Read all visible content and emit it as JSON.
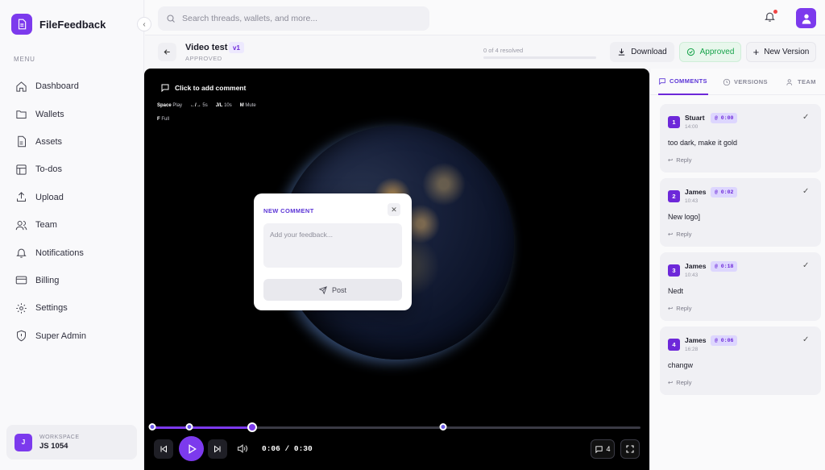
{
  "app": {
    "name": "FileFeedback"
  },
  "sidebar": {
    "menu_label": "MENU",
    "items": [
      {
        "label": "Dashboard",
        "icon": "home-icon"
      },
      {
        "label": "Wallets",
        "icon": "folder-icon"
      },
      {
        "label": "Assets",
        "icon": "file-icon"
      },
      {
        "label": "To-dos",
        "icon": "layout-icon"
      },
      {
        "label": "Upload",
        "icon": "upload-icon"
      },
      {
        "label": "Team",
        "icon": "users-icon"
      },
      {
        "label": "Notifications",
        "icon": "bell-icon"
      },
      {
        "label": "Billing",
        "icon": "credit-card-icon"
      },
      {
        "label": "Settings",
        "icon": "gear-icon"
      },
      {
        "label": "Super Admin",
        "icon": "shield-icon"
      }
    ],
    "workspace": {
      "label": "WORKSPACE",
      "name": "JS 1054",
      "initial": "J"
    }
  },
  "search": {
    "placeholder": "Search threads, wallets, and more..."
  },
  "header": {
    "title": "Video test",
    "version": "v1",
    "status": "APPROVED",
    "progress_text": "0 of 4 resolved",
    "resolved_fraction": 0,
    "download_label": "Download",
    "approved_label": "Approved",
    "new_version_label": "New Version"
  },
  "player": {
    "hint": "Click to add comment",
    "shortcuts": [
      {
        "key": "Space",
        "action": "Play"
      },
      {
        "key": "←/→",
        "action": "5s"
      },
      {
        "key": "J/L",
        "action": "10s"
      },
      {
        "key": "M",
        "action": "Mute"
      }
    ],
    "shortcut_full": {
      "key": "F",
      "action": "Full"
    },
    "current_time": "0:06",
    "duration": "0:30",
    "time_display": "0:06 / 0:30",
    "comment_count": "4"
  },
  "new_comment": {
    "title": "NEW COMMENT",
    "placeholder": "Add your feedback...",
    "post_label": "Post"
  },
  "panel": {
    "tabs": [
      {
        "label": "COMMENTS",
        "active": true
      },
      {
        "label": "VERSIONS",
        "active": false
      },
      {
        "label": "TEAM",
        "active": false
      }
    ],
    "comments": [
      {
        "num": "1",
        "author": "Stuart",
        "timestamp": "@ 0:00",
        "time": "14:00",
        "text": "too dark, make it gold",
        "reply": "Reply"
      },
      {
        "num": "2",
        "author": "James",
        "timestamp": "@ 0:02",
        "time": "10:43",
        "text": "New logo]",
        "reply": "Reply"
      },
      {
        "num": "3",
        "author": "James",
        "timestamp": "@ 0:18",
        "time": "10:43",
        "text": "Nedt",
        "reply": "Reply"
      },
      {
        "num": "4",
        "author": "James",
        "timestamp": "@ 0:06",
        "time": "16:28",
        "text": "changw",
        "reply": "Reply"
      }
    ]
  },
  "colors": {
    "accent": "#7c3aed",
    "approved": "#16a34a"
  }
}
